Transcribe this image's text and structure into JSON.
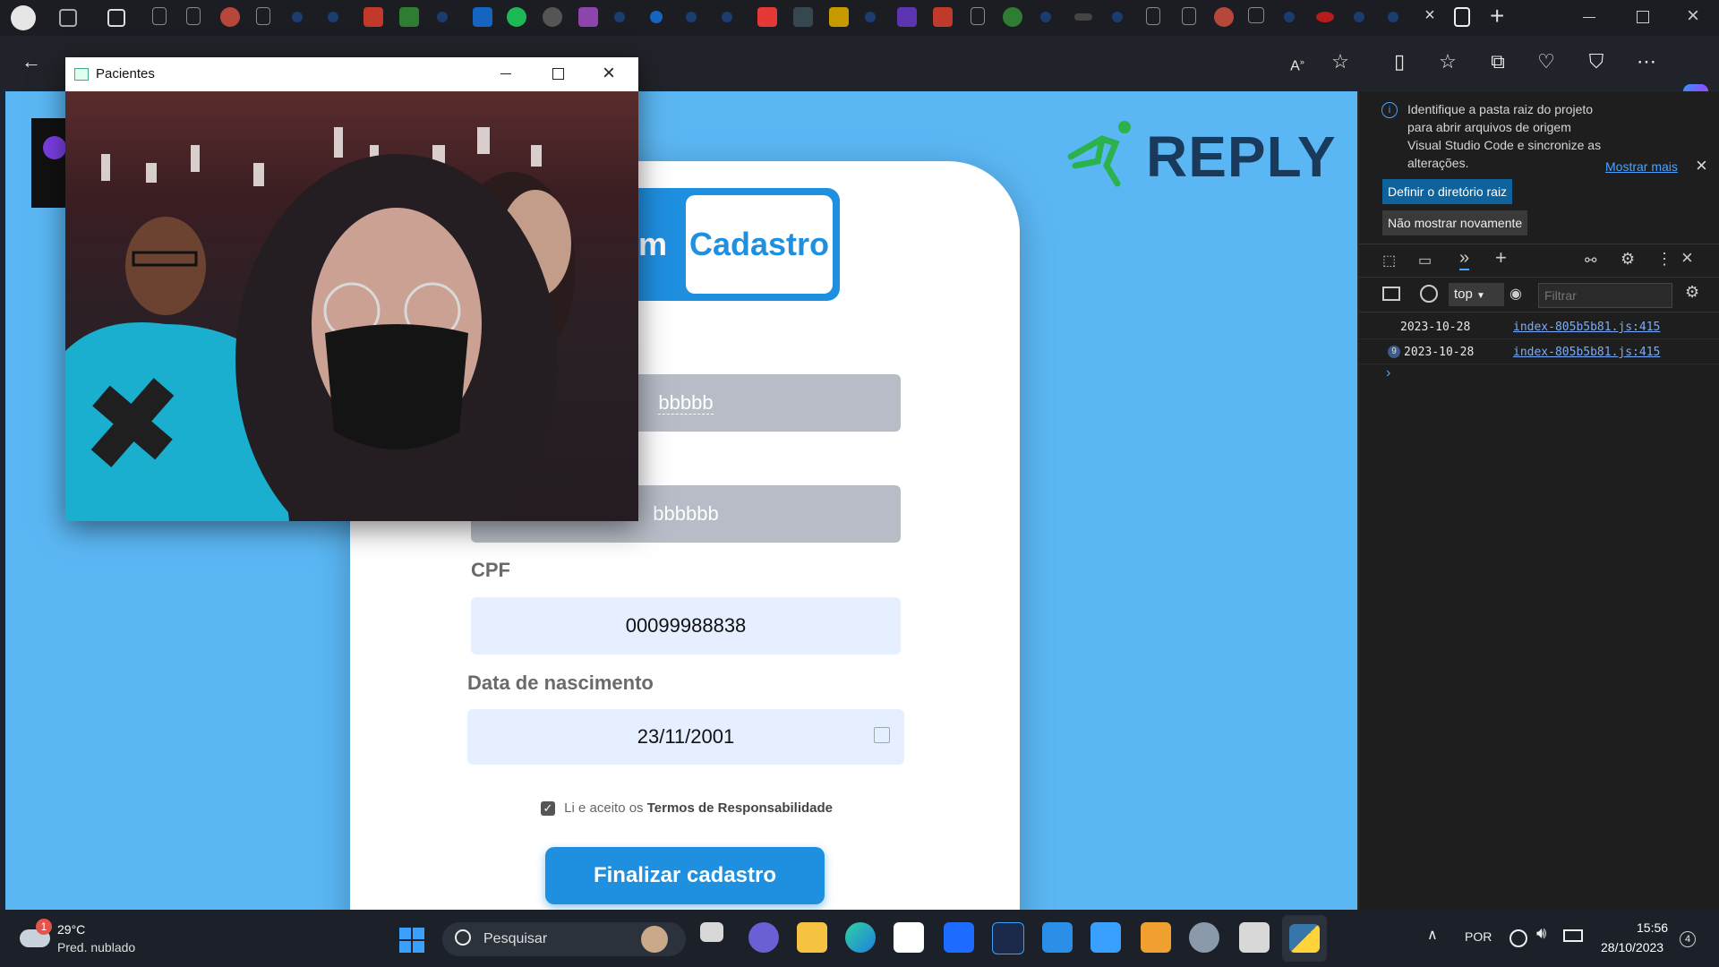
{
  "window": {
    "title": "Pacientes",
    "minimize_icon": "minimize-icon",
    "maximize_icon": "maximize-icon",
    "close_icon": "close-icon"
  },
  "brand": {
    "name": "REPLY",
    "color": "#1a3a5c",
    "accent": "#2bb24c"
  },
  "form": {
    "tab_partial": "m",
    "tab_active": "Cadastro",
    "field1_value": "bbbbb",
    "field2_value": "bbbbbb",
    "cpf_label": "CPF",
    "cpf_value": "00099988838",
    "birth_label": "Data de nascimento",
    "birth_value": "23/11/2001",
    "terms_prefix": "Li e aceito os",
    "terms_link": "Termos de Responsabilidade",
    "submit_label": "Finalizar cadastro",
    "accent_color": "#1f8fe0"
  },
  "devtools": {
    "info_text": "Identifique a pasta raiz do projeto para abrir arquivos de origem Visual Studio Code e sincronize as alterações.",
    "show_more": "Mostrar mais",
    "set_root_button": "Definir o diretório raiz",
    "dont_show_button": "Não mostrar novamente",
    "context": "top",
    "filter_placeholder": "Filtrar",
    "console": [
      {
        "text": "2023-10-28",
        "source": "index-805b5b81.js:415",
        "count": ""
      },
      {
        "text": "2023-10-28",
        "source": "index-805b5b81.js:415",
        "count": "9"
      }
    ]
  },
  "taskbar": {
    "weather_temp": "29°C",
    "weather_desc": "Pred. nublado",
    "weather_badge": "1",
    "search_label": "Pesquisar",
    "language": "POR",
    "time": "15:56",
    "date": "28/10/2023",
    "notification_count": "4"
  }
}
